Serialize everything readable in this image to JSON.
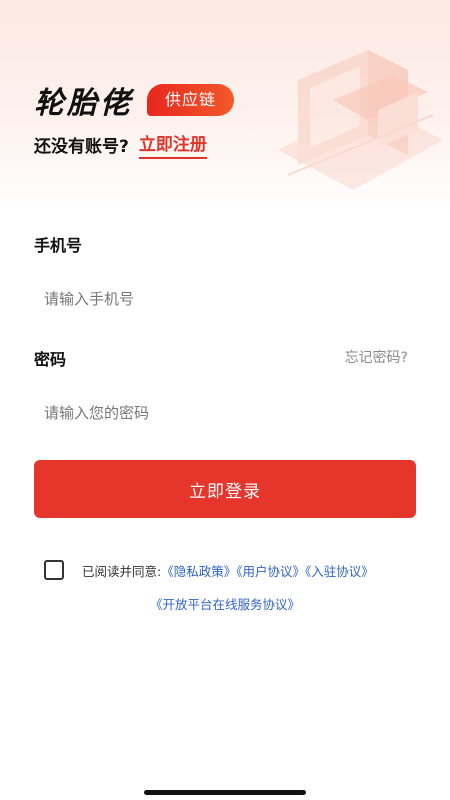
{
  "brand": {
    "name": "轮胎佬",
    "tag": "供应链"
  },
  "signup": {
    "prompt": "还没有账号?",
    "link": "立即注册"
  },
  "phone": {
    "label": "手机号",
    "placeholder": "请输入手机号"
  },
  "password": {
    "label": "密码",
    "placeholder": "请输入您的密码",
    "forgot": "忘记密码?"
  },
  "login": {
    "button": "立即登录"
  },
  "agreement": {
    "prefix": "已阅读并同意:",
    "checked": false,
    "policies": [
      "《隐私政策》",
      "《用户协议》",
      "《入驻协议》",
      "《开放平台在线服务协议》"
    ]
  },
  "colors": {
    "accent": "#e6352b",
    "link": "#2f63c9",
    "hint": "#8a8a8a"
  }
}
